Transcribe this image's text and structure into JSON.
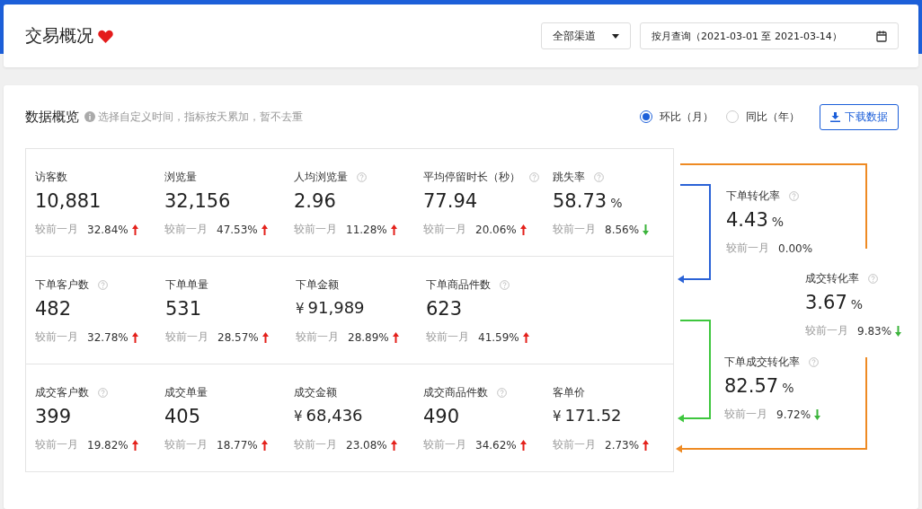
{
  "header": {
    "title": "交易概况",
    "favorite": true,
    "channel": {
      "value": "全部渠道"
    },
    "date_range": {
      "value": "按月查询（2021-03-01 至 2021-03-14）"
    }
  },
  "overview": {
    "title": "数据概览",
    "hint": "选择自定义时间，指标按天累加，暂不去重",
    "compare_options": [
      {
        "label": "环比（月）",
        "selected": true
      },
      {
        "label": "同比（年）",
        "selected": false
      }
    ],
    "download_button": "下载数据",
    "metric_rows": [
      [
        {
          "label": "访客数",
          "help": false,
          "value": "10,881",
          "compare_label": "较前一月",
          "change": "32.84%",
          "rising": true
        },
        {
          "label": "浏览量",
          "help": false,
          "value": "32,156",
          "compare_label": "较前一月",
          "change": "47.53%",
          "rising": true
        },
        {
          "label": "人均浏览量",
          "help": true,
          "value": "2.96",
          "compare_label": "较前一月",
          "change": "11.28%",
          "rising": true
        },
        {
          "label": "平均停留时长（秒）",
          "help": true,
          "value": "77.94",
          "compare_label": "较前一月",
          "change": "20.06%",
          "rising": true
        },
        {
          "label": "跳失率",
          "help": true,
          "value": "58.73",
          "unit": "%",
          "compare_label": "较前一月",
          "change": "8.56%",
          "rising": false
        }
      ],
      [
        {
          "label": "下单客户数",
          "help": true,
          "value": "482",
          "compare_label": "较前一月",
          "change": "32.78%",
          "rising": true
        },
        {
          "label": "下单单量",
          "help": false,
          "value": "531",
          "compare_label": "较前一月",
          "change": "28.57%",
          "rising": true
        },
        {
          "label": "下单金额",
          "help": false,
          "currency": "¥",
          "value": "91,989",
          "compare_label": "较前一月",
          "change": "28.89%",
          "rising": true
        },
        {
          "label": "下单商品件数",
          "help": true,
          "value": "623",
          "compare_label": "较前一月",
          "change": "41.59%",
          "rising": true
        }
      ],
      [
        {
          "label": "成交客户数",
          "help": true,
          "value": "399",
          "compare_label": "较前一月",
          "change": "19.82%",
          "rising": true
        },
        {
          "label": "成交单量",
          "help": false,
          "value": "405",
          "compare_label": "较前一月",
          "change": "18.77%",
          "rising": true
        },
        {
          "label": "成交金额",
          "help": false,
          "currency": "¥",
          "value": "68,436",
          "compare_label": "较前一月",
          "change": "23.08%",
          "rising": true
        },
        {
          "label": "成交商品件数",
          "help": true,
          "value": "490",
          "compare_label": "较前一月",
          "change": "34.62%",
          "rising": true
        },
        {
          "label": "客单价",
          "help": false,
          "currency": "¥",
          "value": "171.52",
          "compare_label": "较前一月",
          "change": "2.73%",
          "rising": true
        }
      ]
    ],
    "conversions": [
      {
        "label": "下单转化率",
        "help": true,
        "value": "4.43",
        "unit": "%",
        "compare_label": "较前一月",
        "change": "0.00%"
      },
      {
        "label": "成交转化率",
        "help": true,
        "value": "3.67",
        "unit": "%",
        "compare_label": "较前一月",
        "change": "9.83%",
        "rising": false
      },
      {
        "label": "下单成交转化率",
        "help": true,
        "value": "82.57",
        "unit": "%",
        "compare_label": "较前一月",
        "change": "9.72%",
        "rising": false
      }
    ]
  }
}
